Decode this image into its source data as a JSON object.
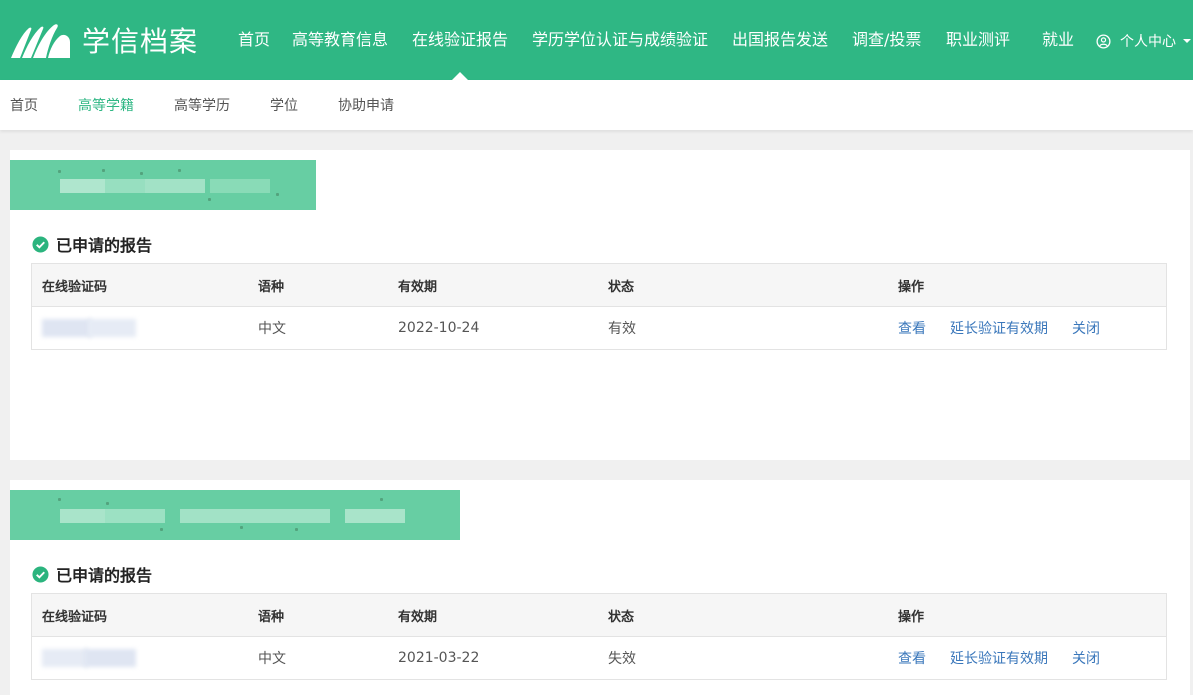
{
  "nav": {
    "logo_text": "学信档案",
    "logo_icon": "book-pages-icon",
    "items": [
      {
        "label": "首页"
      },
      {
        "label": "高等教育信息"
      },
      {
        "label": "在线验证报告",
        "active": true
      },
      {
        "label": "学历学位认证与成绩验证"
      },
      {
        "label": "出国报告发送"
      },
      {
        "label": "调查/投票"
      },
      {
        "label": "职业测评"
      },
      {
        "label": "就业"
      }
    ],
    "user_menu": {
      "label": "个人中心",
      "icon": "user-circle-icon",
      "caret": "caret-down-icon"
    }
  },
  "subnav": {
    "items": [
      {
        "label": "首页"
      },
      {
        "label": "高等学籍",
        "active": true
      },
      {
        "label": "高等学历"
      },
      {
        "label": "学位"
      },
      {
        "label": "协助申请"
      }
    ]
  },
  "report_sections": [
    {
      "heading": "已申请的报告",
      "heading_icon": "check-circle-icon",
      "columns": [
        "在线验证码",
        "语种",
        "有效期",
        "状态",
        "操作"
      ],
      "rows": [
        {
          "language": "中文",
          "expiry": "2022-10-24",
          "status": "有效",
          "actions": [
            "查看",
            "延长验证有效期",
            "关闭"
          ]
        }
      ]
    },
    {
      "heading": "已申请的报告",
      "heading_icon": "check-circle-icon",
      "columns": [
        "在线验证码",
        "语种",
        "有效期",
        "状态",
        "操作"
      ],
      "rows": [
        {
          "language": "中文",
          "expiry": "2021-03-22",
          "status": "失效",
          "actions": [
            "查看",
            "延长验证有效期",
            "关闭"
          ]
        }
      ]
    }
  ],
  "colors": {
    "brand_green": "#2fb784",
    "link_blue": "#3a77bb",
    "page_bg": "#f0f0f0"
  }
}
